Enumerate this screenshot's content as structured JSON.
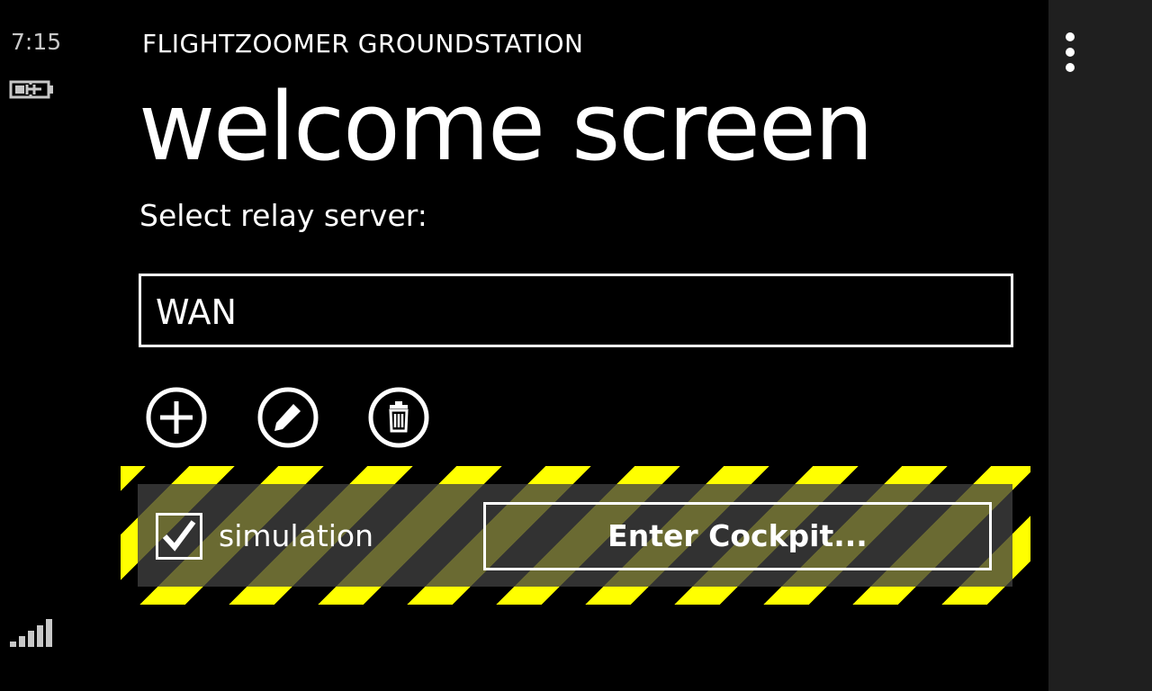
{
  "status_bar": {
    "time": "7:15",
    "battery_icon": "battery-charging-icon",
    "signal_icon": "signal-strength-icon"
  },
  "app": {
    "title": "FLIGHTZOOMER GROUNDSTATION",
    "page_title": "welcome screen"
  },
  "relay": {
    "label": "Select relay server:",
    "selected": "WAN",
    "actions": {
      "add_icon": "add-circle-icon",
      "edit_icon": "edit-pencil-icon",
      "delete_icon": "trash-icon"
    }
  },
  "launch_panel": {
    "simulation_label": "simulation",
    "simulation_checked": true,
    "enter_label": "Enter Cockpit...",
    "stripe_colors": [
      "#ffff00",
      "#000000"
    ]
  },
  "app_bar": {
    "menu_icon": "ellipsis-icon"
  }
}
